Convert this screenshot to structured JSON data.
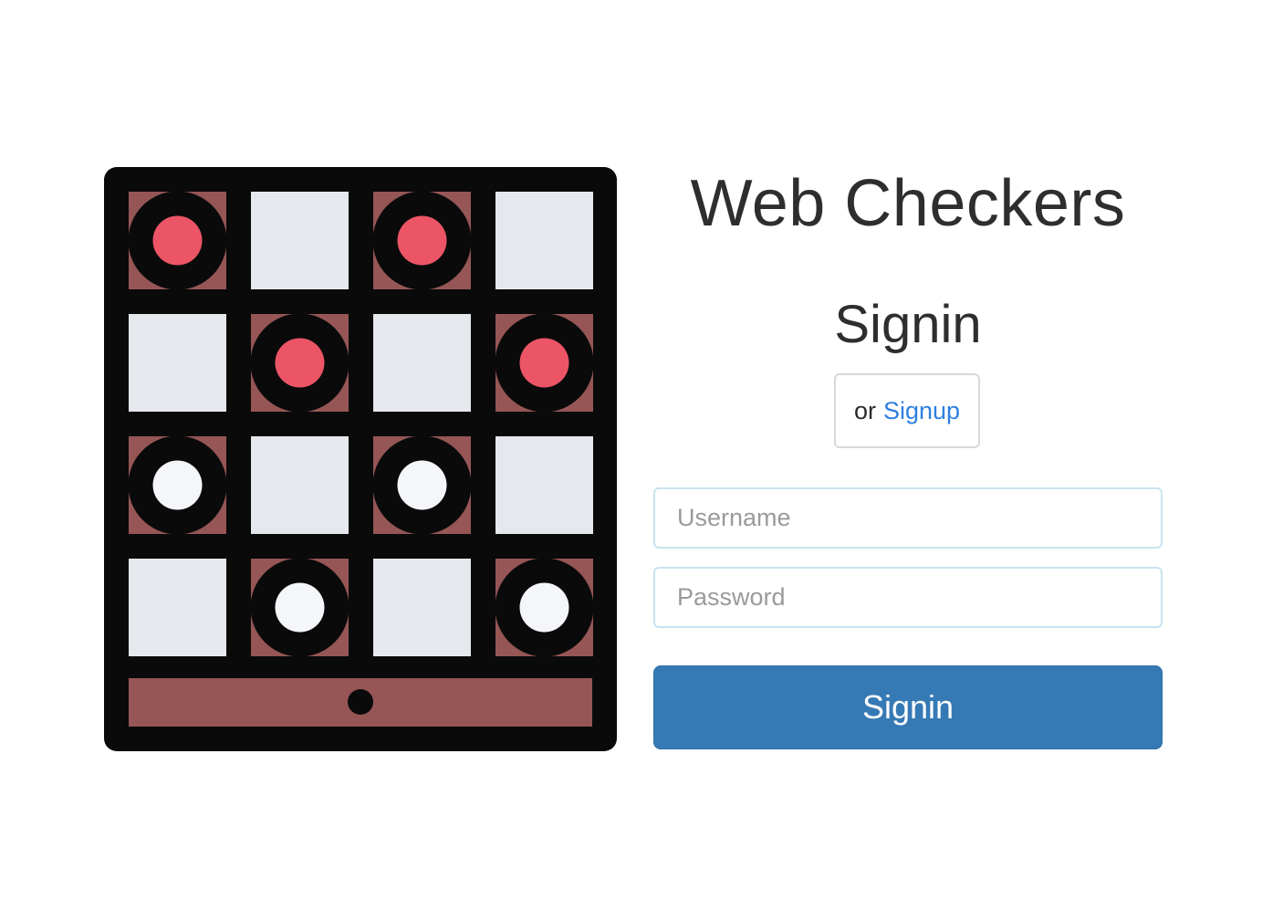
{
  "app": {
    "title": "Web Checkers"
  },
  "colors": {
    "frame": "#0a0a0a",
    "dark_square": "#955655",
    "light_square": "#e5e8ec",
    "red_piece": "#ec5566",
    "white_piece": "#f5f6fa",
    "accent_link": "#2f7fe0",
    "primary_button": "#367ab5"
  },
  "illustration": {
    "icon": "checkers-board-icon",
    "rows": [
      [
        "red",
        "empty",
        "red",
        "empty"
      ],
      [
        "empty",
        "red",
        "empty",
        "red"
      ],
      [
        "white",
        "empty",
        "white",
        "empty"
      ],
      [
        "empty",
        "white",
        "empty",
        "white"
      ]
    ]
  },
  "signin_form": {
    "heading": "Signin",
    "alternative_prefix": "or",
    "signup_link": "Signup",
    "username_placeholder": "Username",
    "password_placeholder": "Password",
    "submit_label": "Signin"
  }
}
